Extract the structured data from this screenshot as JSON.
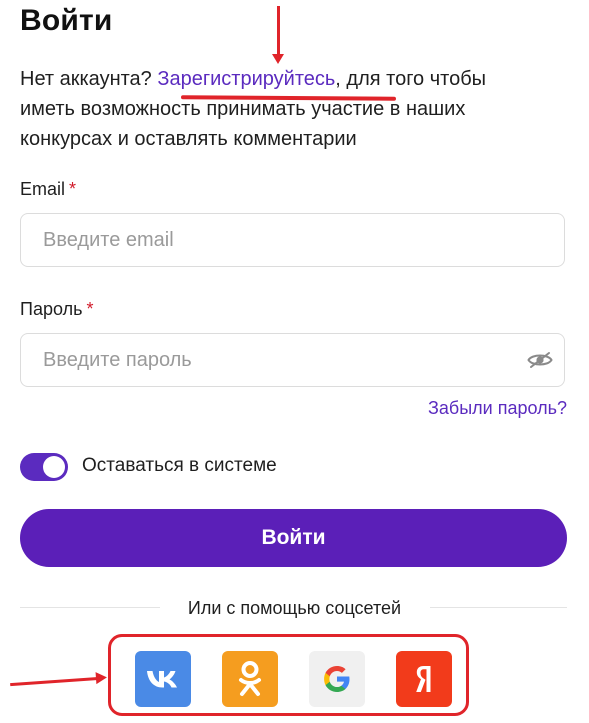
{
  "header": {
    "title": "Войти"
  },
  "intro": {
    "prefix": "Нет аккаунта? ",
    "register_link": "Зарегистрируйтесь",
    "suffix": ", для того чтобы иметь возможность принимать участие в наших конкурсах и оставлять комментарии"
  },
  "form": {
    "email": {
      "label": "Email",
      "required_mark": "*",
      "placeholder": "Введите email",
      "value": ""
    },
    "password": {
      "label": "Пароль",
      "required_mark": "*",
      "placeholder": "Введите пароль",
      "value": "",
      "visibility_icon": "eye-hidden-icon"
    },
    "forgot_link": "Забыли пароль?",
    "remember": {
      "label": "Оставаться в системе",
      "checked": true
    },
    "submit_label": "Войти"
  },
  "social": {
    "divider_text": "Или с помощью соцсетей",
    "buttons": [
      {
        "name": "vk",
        "icon": "vk-icon",
        "color": "#4a8ae6"
      },
      {
        "name": "odnoklassniki",
        "icon": "ok-icon",
        "color": "#f59d1f"
      },
      {
        "name": "google",
        "icon": "google-icon",
        "color": "#f0f0f0"
      },
      {
        "name": "yandex",
        "icon": "yandex-icon",
        "color": "#f23b1b"
      }
    ]
  },
  "colors": {
    "accent": "#5b2bbf",
    "button": "#5b1fb8",
    "required": "#d11a2a",
    "annotation": "#e0242a"
  }
}
